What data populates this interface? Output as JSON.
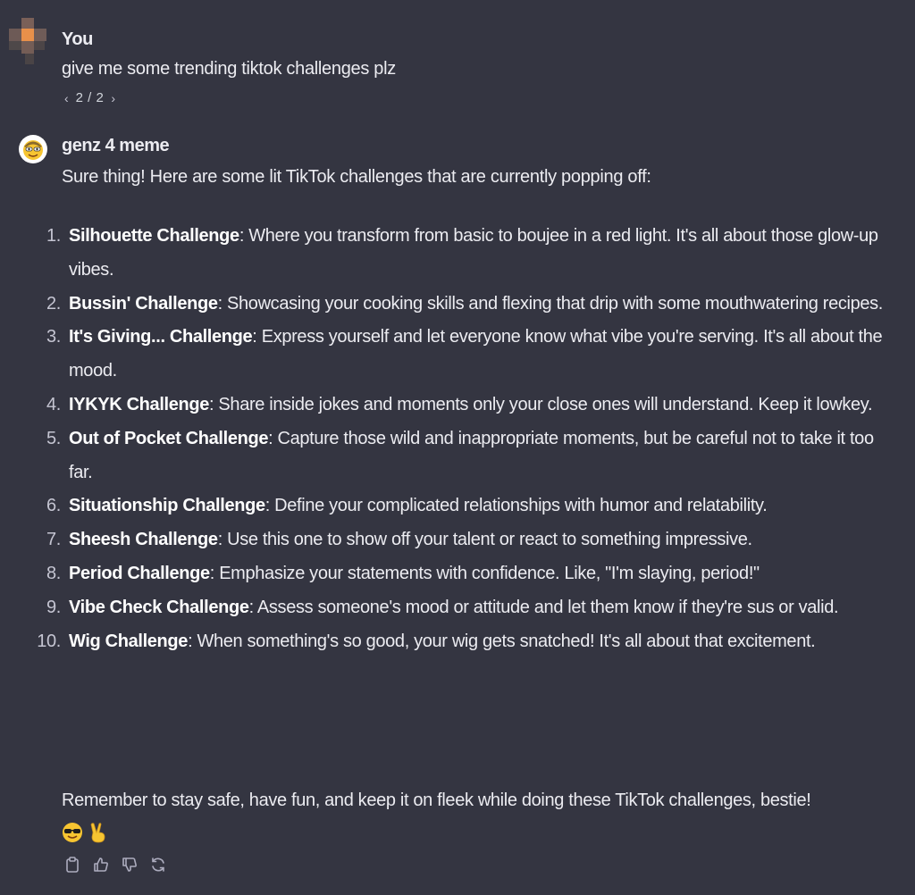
{
  "user_turn": {
    "author": "You",
    "message": "give me some trending tiktok challenges plz",
    "pager": {
      "prev_icon": "chevron-left-icon",
      "count": "2 / 2",
      "next_icon": "chevron-right-icon"
    }
  },
  "bot_turn": {
    "author": "genz 4 meme",
    "intro": "Sure thing! Here are some lit TikTok challenges that are currently popping off:",
    "items": [
      {
        "num": "1.",
        "title": "Silhouette Challenge",
        "text": ": Where you transform from basic to boujee in a red light. It's all about those glow-up vibes."
      },
      {
        "num": "2.",
        "title": "Bussin' Challenge",
        "text": ": Showcasing your cooking skills and flexing that drip with some mouthwatering recipes."
      },
      {
        "num": "3.",
        "title": "It's Giving... Challenge",
        "text": ": Express yourself and let everyone know what vibe you're serving. It's all about the mood."
      },
      {
        "num": "4.",
        "title": "IYKYK Challenge",
        "text": ": Share inside jokes and moments only your close ones will understand. Keep it lowkey."
      },
      {
        "num": "5.",
        "title": "Out of Pocket Challenge",
        "text": ": Capture those wild and inappropriate moments, but be careful not to take it too far."
      },
      {
        "num": "6.",
        "title": "Situationship Challenge",
        "text": ": Define your complicated relationships with humor and relatability."
      },
      {
        "num": "7.",
        "title": "Sheesh Challenge",
        "text": ": Use this one to show off your talent or react to something impressive."
      },
      {
        "num": "8.",
        "title": "Period Challenge",
        "text": ": Emphasize your statements with confidence. Like, \"I'm slaying, period!\""
      },
      {
        "num": "9.",
        "title": "Vibe Check Challenge",
        "text": ": Assess someone's mood or attitude and let them know if they're sus or valid."
      },
      {
        "num": "10.",
        "title": "Wig Challenge",
        "text": ": When something's so good, your wig gets snatched! It's all about that excitement."
      }
    ],
    "outro": "Remember to stay safe, have fun, and keep it on fleek while doing these TikTok challenges, bestie!",
    "outro_emojis": [
      "sunglasses-emoji",
      "victory-hand-emoji"
    ],
    "actions": [
      "clipboard-icon",
      "thumbs-up-icon",
      "thumbs-down-icon",
      "regenerate-icon"
    ]
  },
  "colors": {
    "background": "#343541",
    "text": "#ececf1",
    "muted": "#c5c5d2",
    "user_avatar_accent": "#e8904a"
  }
}
